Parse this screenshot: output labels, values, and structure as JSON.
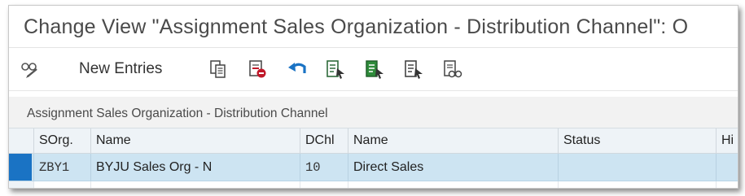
{
  "window": {
    "title": "Change View \"Assignment Sales Organization - Distribution Channel\": O"
  },
  "toolbar": {
    "new_entries_label": "New Entries",
    "icons": [
      "display-change-icon",
      "copy-icon",
      "delete-icon",
      "undo-icon",
      "select-all-icon",
      "select-block-icon",
      "deselect-all-icon",
      "print-icon"
    ]
  },
  "section": {
    "title": "Assignment Sales Organization - Distribution Channel"
  },
  "table": {
    "columns": [
      "SOrg.",
      "Name",
      "DChl",
      "Name",
      "Status",
      "Hi"
    ],
    "rows": [
      {
        "sorg": "ZBY1",
        "sorg_name": "BYJU Sales Org - N",
        "dchl": "10",
        "dchl_name": "Direct Sales",
        "status": "",
        "hi": ""
      }
    ]
  },
  "colors": {
    "selected_row": "#cde4f2",
    "row_selector": "#1a73c4",
    "header_bg": "#eef3f7",
    "area_bg": "#f2f2f2"
  }
}
